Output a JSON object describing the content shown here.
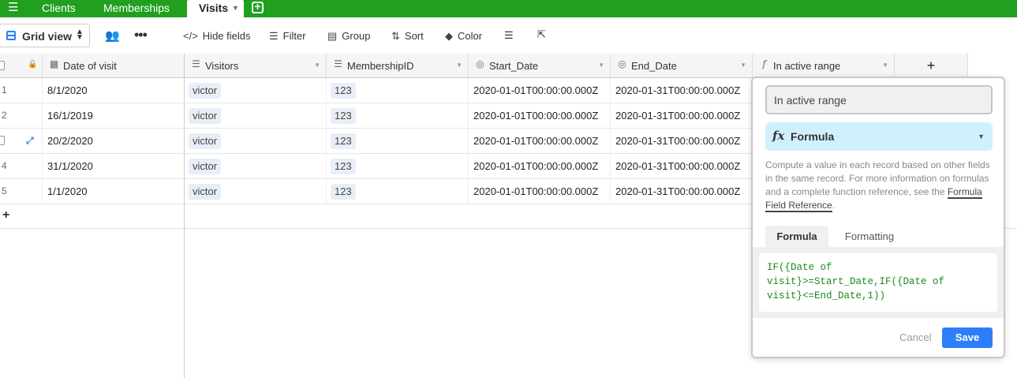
{
  "tabs": {
    "clients": "Clients",
    "memberships": "Memberships",
    "visits": "Visits"
  },
  "toolbar": {
    "view_name": "Grid view",
    "hide_fields": "Hide fields",
    "filter": "Filter",
    "group": "Group",
    "sort": "Sort",
    "color": "Color"
  },
  "columns": {
    "date_of_visit": "Date of visit",
    "visitors": "Visitors",
    "membership_id": "MembershipID",
    "start_date": "Start_Date",
    "end_date": "End_Date",
    "in_active_range": "In active range",
    "add": "+"
  },
  "rows": [
    {
      "num": "1",
      "date": "8/1/2020",
      "visitor": "victor",
      "membership": "123",
      "start": "2020-01-01T00:00:00.000Z",
      "end": "2020-01-31T00:00:00.000Z"
    },
    {
      "num": "2",
      "date": "16/1/2019",
      "visitor": "victor",
      "membership": "123",
      "start": "2020-01-01T00:00:00.000Z",
      "end": "2020-01-31T00:00:00.000Z"
    },
    {
      "num": "",
      "date": "20/2/2020",
      "visitor": "victor",
      "membership": "123",
      "start": "2020-01-01T00:00:00.000Z",
      "end": "2020-01-31T00:00:00.000Z"
    },
    {
      "num": "4",
      "date": "31/1/2020",
      "visitor": "victor",
      "membership": "123",
      "start": "2020-01-01T00:00:00.000Z",
      "end": "2020-01-31T00:00:00.000Z"
    },
    {
      "num": "5",
      "date": "1/1/2020",
      "visitor": "victor",
      "membership": "123",
      "start": "2020-01-01T00:00:00.000Z",
      "end": "2020-01-31T00:00:00.000Z"
    }
  ],
  "add_row": "+",
  "field_editor": {
    "field_name": "In active range",
    "field_type": "Formula",
    "description_text": "Compute a value in each record based on other fields in the same record. For more information on formulas and a complete function reference, see the ",
    "description_link": "Formula Field Reference",
    "description_end": ".",
    "tab_formula": "Formula",
    "tab_formatting": "Formatting",
    "formula_line1": "IF({Date of",
    "formula_line2": "visit}>=Start_Date,IF({Date of",
    "formula_line3": "visit}<=End_Date,1))",
    "cancel": "Cancel",
    "save": "Save"
  },
  "colors": {
    "tabbar": "#20a01e",
    "accent": "#2d7ff9",
    "formula_type_bg": "#d0f0fd",
    "formula_text": "#1c8a1c"
  }
}
